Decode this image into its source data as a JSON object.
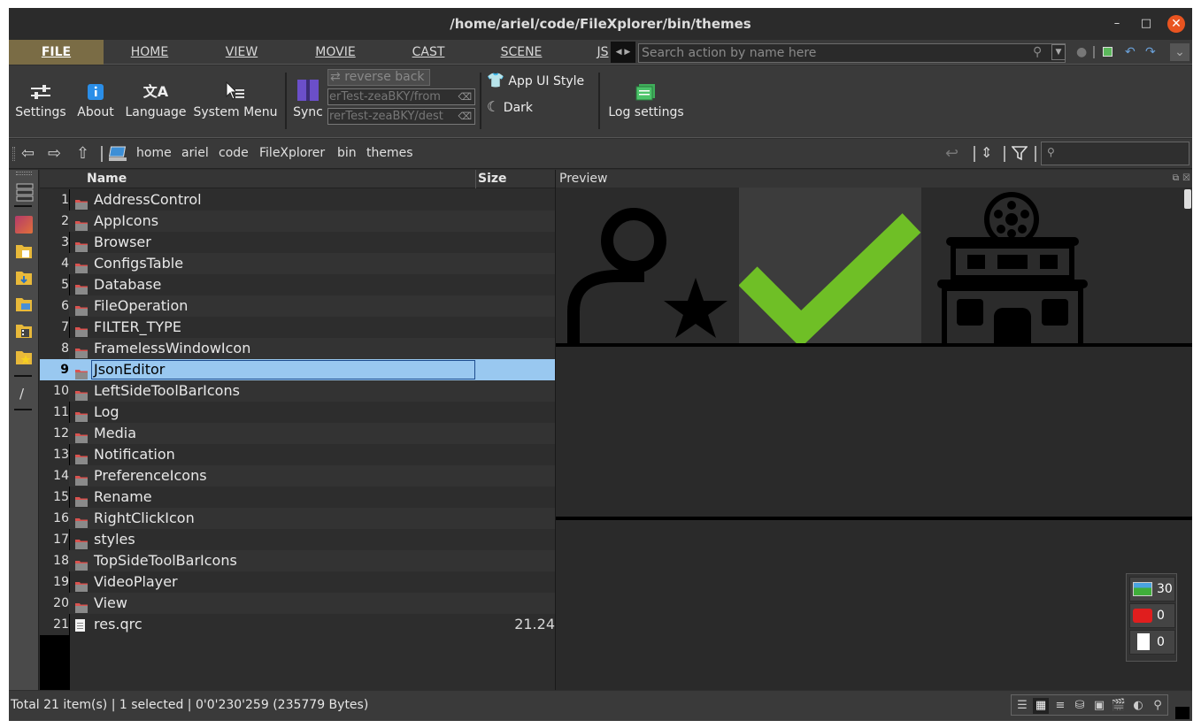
{
  "window": {
    "title": "/home/ariel/code/FileXplorer/bin/themes"
  },
  "tabs": [
    "FILE",
    "HOME",
    "VIEW",
    "MOVIE",
    "CAST",
    "SCENE",
    "JS"
  ],
  "search": {
    "placeholder": "Search action by name here"
  },
  "ribbon": {
    "settings": "Settings",
    "about": "About",
    "language": "Language",
    "system_menu": "System Menu",
    "sync": "Sync",
    "reverse_back": "reverse back",
    "from_path": "erTest-zeaBKY/from",
    "dest_path": "rerTest-zeaBKY/dest",
    "app_ui_style": "App UI Style",
    "dark": "Dark",
    "log_settings": "Log settings"
  },
  "breadcrumb": [
    "home",
    "ariel",
    "code",
    "FileXplorer",
    "bin",
    "themes"
  ],
  "table": {
    "headers": {
      "name": "Name",
      "size": "Size"
    },
    "rows": [
      {
        "n": "1",
        "name": "AddressControl",
        "size": "",
        "type": "folder"
      },
      {
        "n": "2",
        "name": "AppIcons",
        "size": "",
        "type": "folder"
      },
      {
        "n": "3",
        "name": "Browser",
        "size": "",
        "type": "folder"
      },
      {
        "n": "4",
        "name": "ConfigsTable",
        "size": "",
        "type": "folder"
      },
      {
        "n": "5",
        "name": "Database",
        "size": "",
        "type": "folder"
      },
      {
        "n": "6",
        "name": "FileOperation",
        "size": "",
        "type": "folder"
      },
      {
        "n": "7",
        "name": "FILTER_TYPE",
        "size": "",
        "type": "folder"
      },
      {
        "n": "8",
        "name": "FramelessWindowIcon",
        "size": "",
        "type": "folder"
      },
      {
        "n": "9",
        "name": "JsonEditor",
        "size": "",
        "type": "folder"
      },
      {
        "n": "10",
        "name": "LeftSideToolBarIcons",
        "size": "",
        "type": "folder"
      },
      {
        "n": "11",
        "name": "Log",
        "size": "",
        "type": "folder"
      },
      {
        "n": "12",
        "name": "Media",
        "size": "",
        "type": "folder"
      },
      {
        "n": "13",
        "name": "Notification",
        "size": "",
        "type": "folder"
      },
      {
        "n": "14",
        "name": "PreferenceIcons",
        "size": "",
        "type": "folder"
      },
      {
        "n": "15",
        "name": "Rename",
        "size": "",
        "type": "folder"
      },
      {
        "n": "16",
        "name": "RightClickIcon",
        "size": "",
        "type": "folder"
      },
      {
        "n": "17",
        "name": "styles",
        "size": "",
        "type": "folder"
      },
      {
        "n": "18",
        "name": "TopSideToolBarIcons",
        "size": "",
        "type": "folder"
      },
      {
        "n": "19",
        "name": "VideoPlayer",
        "size": "",
        "type": "folder"
      },
      {
        "n": "20",
        "name": "View",
        "size": "",
        "type": "folder"
      },
      {
        "n": "21",
        "name": "res.qrc",
        "size": "21.24",
        "type": "file"
      }
    ],
    "selected_index": 8
  },
  "preview": {
    "title": "Preview"
  },
  "counters": {
    "images": "30",
    "videos": "0",
    "others": "0"
  },
  "status": {
    "text": "Total 21 item(s) |  1 selected |  0'0'230'259 (235779 Bytes)"
  },
  "colors": {
    "accent_tab": "#7a6c45",
    "selection": "#99c8f0",
    "check": "#6fbf26",
    "folder": "#d9534f"
  },
  "icons": [
    "settings-sliders-icon",
    "info-icon",
    "language-icon",
    "system-menu-icon",
    "sync-icon",
    "shirt-icon",
    "moon-icon",
    "log-settings-icon",
    "back-icon",
    "forward-icon",
    "up-icon",
    "computer-icon",
    "filter-icon"
  ]
}
